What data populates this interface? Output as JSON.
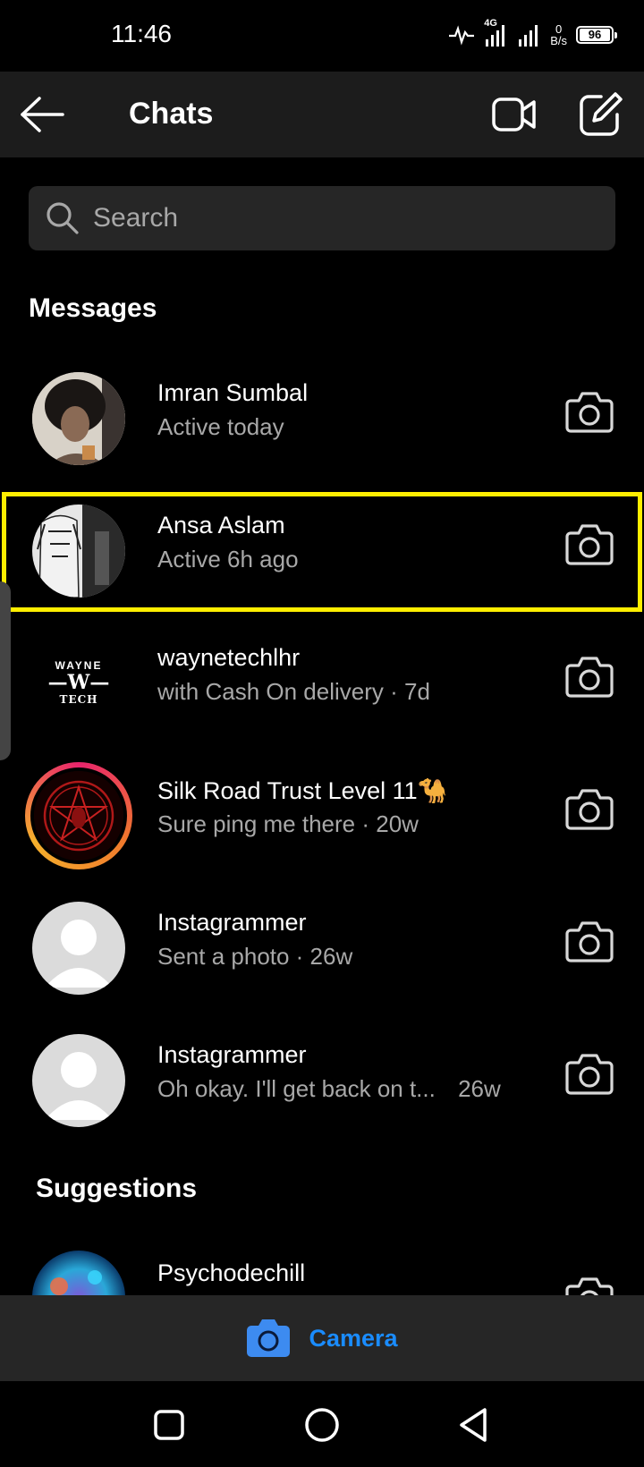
{
  "status_bar": {
    "time": "11:46",
    "network": "4G",
    "speed_value": "0",
    "speed_unit": "B/s",
    "battery": "96"
  },
  "header": {
    "title": "Chats",
    "back_icon": "arrow-left-icon",
    "video_icon": "video-camera-icon",
    "compose_icon": "compose-icon"
  },
  "search": {
    "placeholder": "Search"
  },
  "messages": {
    "section_title": "Messages",
    "items": [
      {
        "name": "Imran Sumbal",
        "subtitle": "Active today"
      },
      {
        "name": "Ansa Aslam",
        "subtitle": "Active 6h ago"
      },
      {
        "name": "waynetechlhr",
        "subtitle": "with Cash On delivery · 7d",
        "avatar_text_top": "WAYNE",
        "avatar_text_bottom": "TECH"
      },
      {
        "name": "Silk Road Trust Level 11🐪",
        "subtitle": "Sure ping me there · 20w"
      },
      {
        "name": "Instagrammer",
        "subtitle": "Sent a photo · 26w"
      },
      {
        "name": "Instagrammer",
        "subtitle": "Oh okay. I'll get back on t...",
        "time": "26w"
      }
    ]
  },
  "suggestions": {
    "section_title": "Suggestions",
    "items": [
      {
        "name": "Psychodechill"
      }
    ]
  },
  "camera_bar": {
    "label": "Camera"
  },
  "colors": {
    "background": "#000000",
    "header_bg": "#1c1c1c",
    "accent": "#1a8cff",
    "highlight": "#ffee00",
    "secondary_text": "#a8a8a8"
  }
}
